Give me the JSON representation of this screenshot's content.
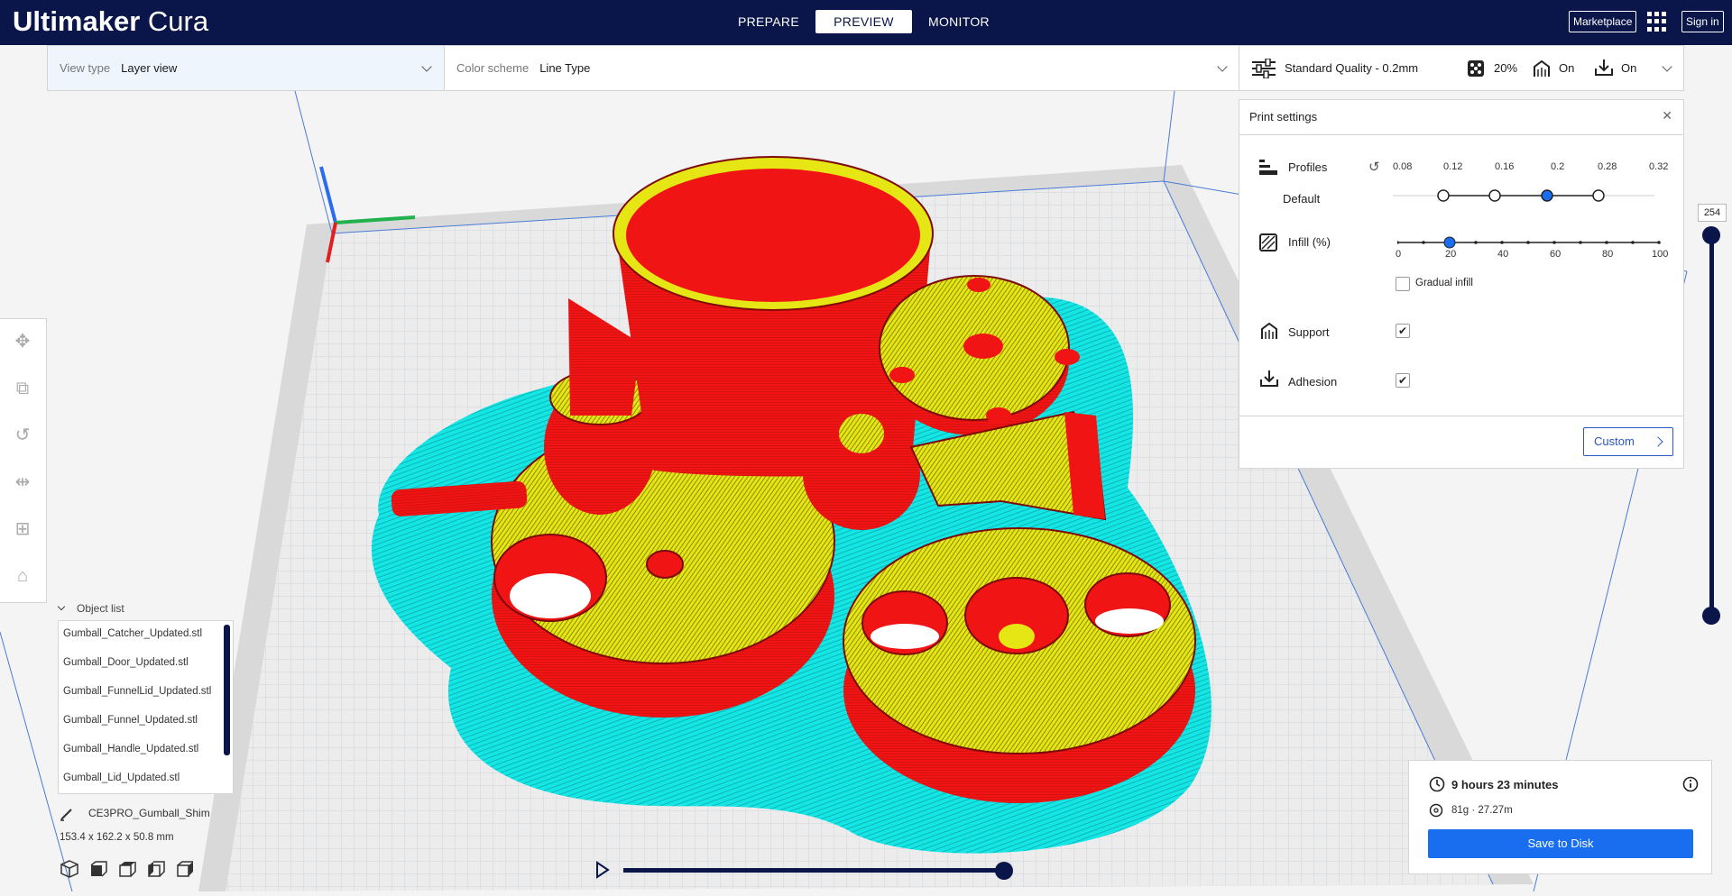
{
  "app": {
    "brand_bold": "Ultimaker",
    "brand_light": "Cura"
  },
  "stages": [
    {
      "label": "PREPARE"
    },
    {
      "label": "PREVIEW"
    },
    {
      "label": "MONITOR"
    }
  ],
  "topbar": {
    "marketplace_label": "Marketplace",
    "signin_label": "Sign in"
  },
  "header": {
    "view_type_label": "View type",
    "view_type_value": "Layer view",
    "color_scheme_label": "Color scheme",
    "color_scheme_value": "Line Type",
    "quality": "Standard Quality - 0.2mm",
    "infill": "20%",
    "support": "On",
    "adhesion": "On"
  },
  "print_settings": {
    "title": "Print settings",
    "profiles_label": "Profiles",
    "profile_default": "Default",
    "layer_heights": [
      "0.08",
      "0.12",
      "0.16",
      "0.2",
      "0.28",
      "0.32"
    ],
    "selected_layer_height": "0.2",
    "infill_label": "Infill (%)",
    "infill_ticks": [
      "0",
      "20",
      "40",
      "60",
      "80",
      "100"
    ],
    "infill_value": 20,
    "gradual_infill_label": "Gradual infill",
    "gradual_infill_checked": false,
    "support_label": "Support",
    "support_checked": true,
    "adhesion_label": "Adhesion",
    "adhesion_checked": true,
    "custom_label": "Custom"
  },
  "object_list": {
    "header": "Object list",
    "items": [
      "Gumball_Catcher_Updated.stl",
      "Gumball_Door_Updated.stl",
      "Gumball_FunnelLid_Updated.stl",
      "Gumball_Funnel_Updated.stl",
      "Gumball_Handle_Updated.stl",
      "Gumball_Lid_Updated.stl"
    ],
    "job_name": "CE3PRO_Gumball_Shim",
    "dimensions": "153.4 x 162.2 x 50.8 mm"
  },
  "layer_slider": {
    "value": "254"
  },
  "job": {
    "time": "9 hours 23 minutes",
    "material": "81g · 27.27m",
    "save_label": "Save to Disk"
  },
  "colors": {
    "brand_navy": "#0a1549",
    "accent_blue": "#196ef0",
    "wall_red": "#f01414",
    "skin_yellow": "#e6e614",
    "support_cyan": "#14e6e6"
  }
}
